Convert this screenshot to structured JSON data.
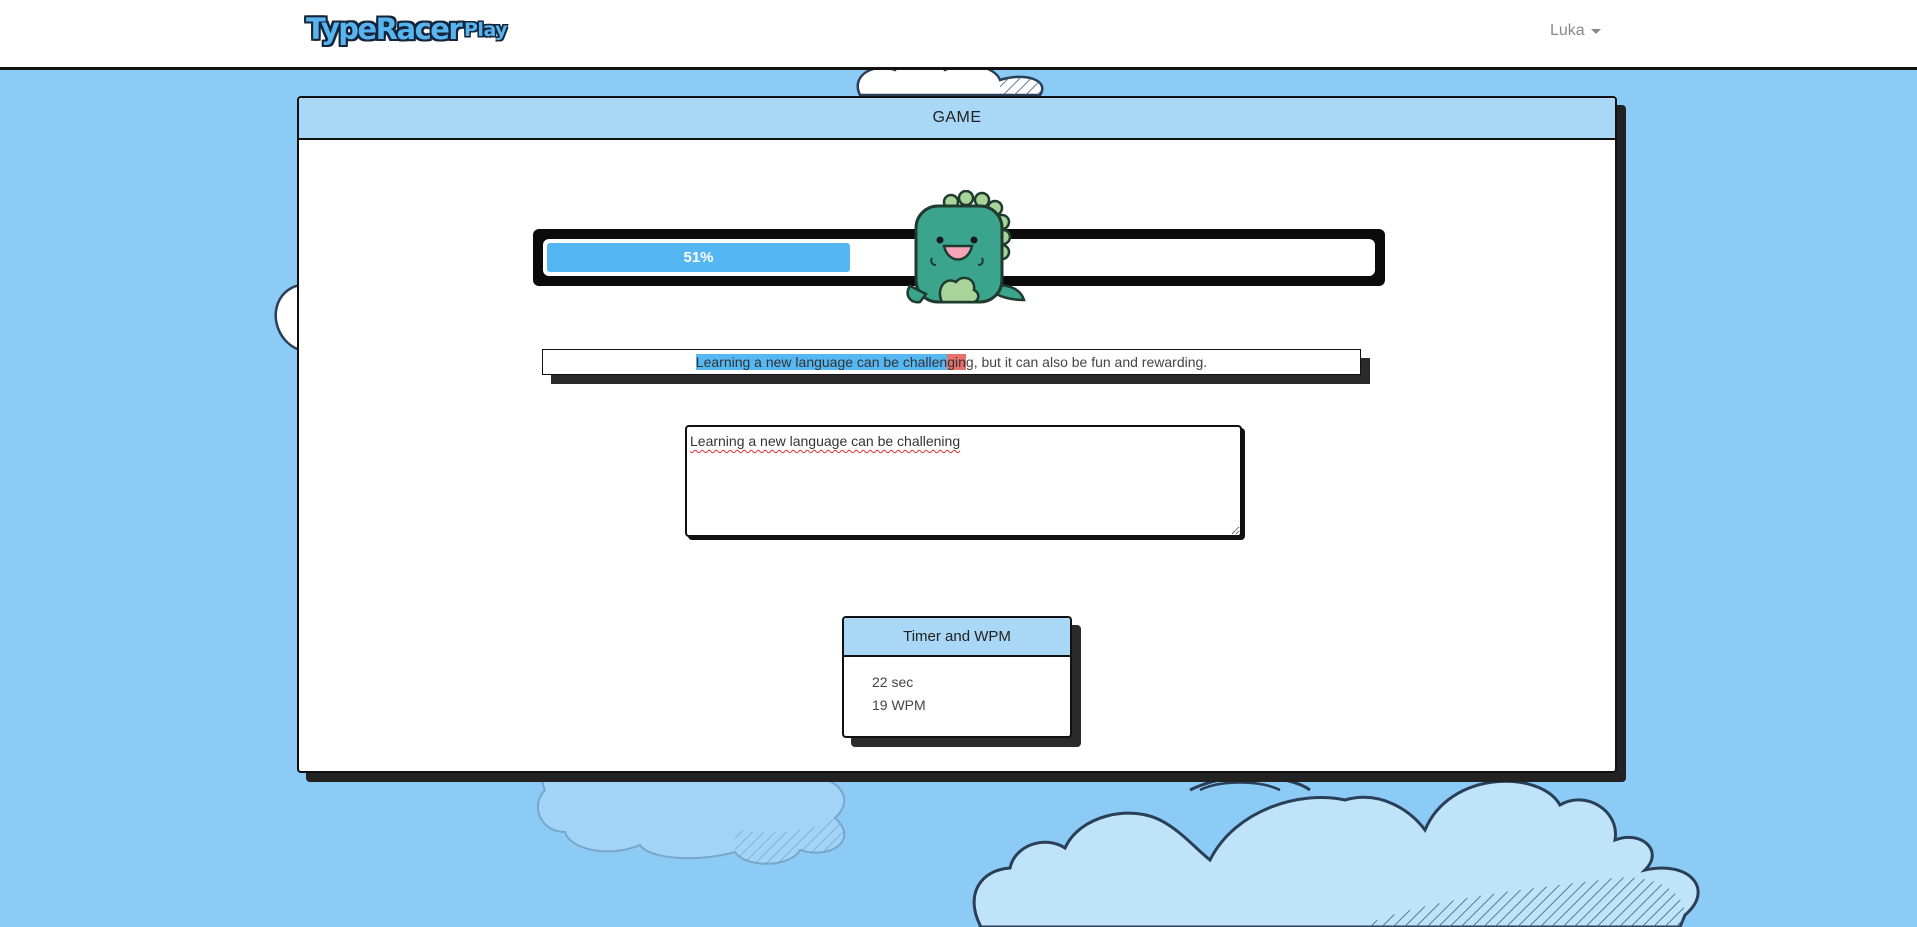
{
  "navbar": {
    "brand": "TypeRacer",
    "play_label": "Play",
    "user_name": "Luka"
  },
  "game": {
    "header": "GAME",
    "progress_percent": 51,
    "progress_label": "51%",
    "quote": {
      "typed_correct": "Learning a new language can be challen",
      "typed_error": "gin",
      "remaining": "g, but it can also be fun and rewarding."
    },
    "input_value": "Learning a new language can be challening"
  },
  "stats": {
    "header": "Timer and WPM",
    "time": "22 sec",
    "wpm": "19 WPM"
  },
  "colors": {
    "background": "#8ccbf6",
    "header_fill": "#a8d8f6",
    "progress": "#54b7f4",
    "correct_highlight": "#56b8f2",
    "error_highlight": "#e8716e"
  }
}
